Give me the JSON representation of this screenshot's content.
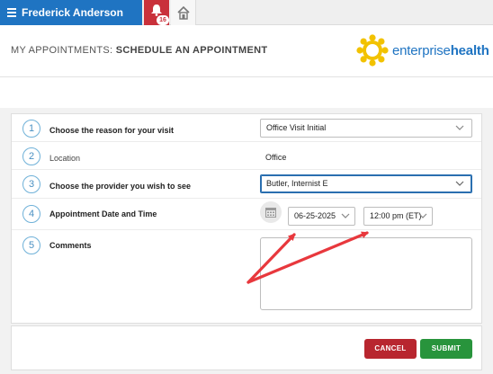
{
  "topbar": {
    "user_name": "Frederick Anderson",
    "notification_count": "16"
  },
  "header": {
    "title_prefix": "MY APPOINTMENTS: ",
    "title_main": "SCHEDULE AN APPOINTMENT",
    "logo_text_light": "enterprise",
    "logo_text_bold": "health"
  },
  "form": {
    "rows": [
      {
        "step": "1",
        "label": "Choose the reason for your visit",
        "value": "Office Visit Initial"
      },
      {
        "step": "2",
        "label": "Location",
        "value": "Office"
      },
      {
        "step": "3",
        "label": "Choose the provider you wish to see",
        "value": "Butler, Internist E"
      },
      {
        "step": "4",
        "label": "Appointment Date and Time",
        "date": "06-25-2025",
        "time": "12:00 pm (ET)"
      },
      {
        "step": "5",
        "label": "Comments",
        "value": ""
      }
    ]
  },
  "footer": {
    "cancel_label": "CANCEL",
    "submit_label": "SUBMIT"
  },
  "colors": {
    "primary": "#1f74c2",
    "notification": "#c9313b",
    "cancel": "#b8262f",
    "submit": "#28943c",
    "annotation_arrow": "#e8383d"
  }
}
